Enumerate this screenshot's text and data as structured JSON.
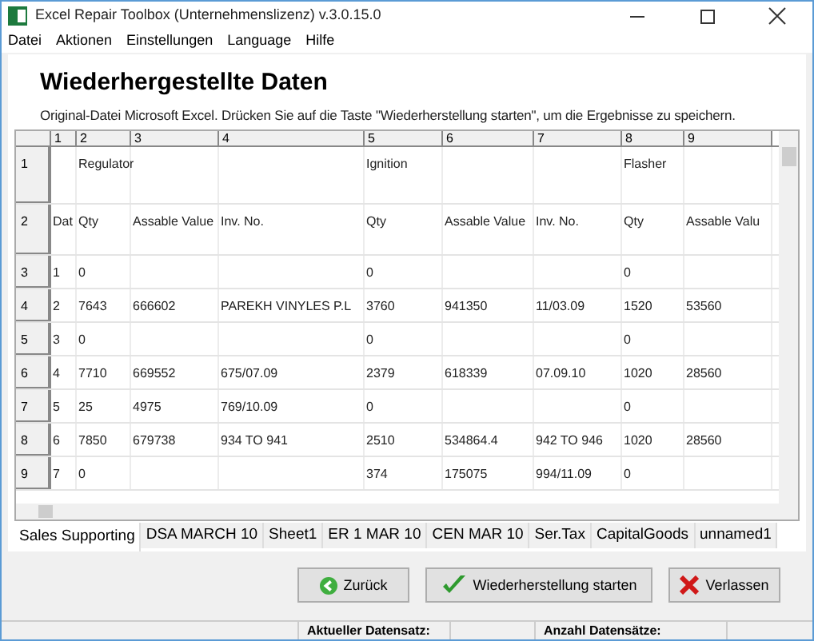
{
  "window": {
    "title": "Excel Repair Toolbox (Unternehmenslizenz) v.3.0.15.0"
  },
  "menu": [
    "Datei",
    "Aktionen",
    "Einstellungen",
    "Language",
    "Hilfe"
  ],
  "heading": "Wiederhergestellte Daten",
  "description": "Original-Datei Microsoft Excel. Drücken Sie auf die Taste \"Wiederherstellung starten\", um die Ergebnisse zu speichern.",
  "grid": {
    "columns": [
      "1",
      "2",
      "3",
      "4",
      "5",
      "6",
      "7",
      "8",
      "9"
    ],
    "rows": [
      {
        "header": "1",
        "cells": [
          null,
          "Regulator",
          null,
          null,
          "Ignition",
          null,
          null,
          "Flasher",
          null
        ]
      },
      {
        "header": "2",
        "cells": [
          "Dat",
          "Qty",
          "Assable Value",
          "Inv. No.",
          "Qty",
          "Assable Value",
          "Inv. No.",
          "Qty",
          "Assable Valu"
        ]
      },
      {
        "header": "3",
        "cells": [
          "1",
          "0",
          null,
          null,
          "0",
          null,
          null,
          "0",
          null
        ]
      },
      {
        "header": "4",
        "cells": [
          "2",
          "7643",
          "666602",
          "PAREKH VINYLES P.L",
          "3760",
          "941350",
          "11/03.09",
          "1520",
          "53560"
        ]
      },
      {
        "header": "5",
        "cells": [
          "3",
          "0",
          null,
          null,
          "0",
          null,
          null,
          "0",
          null
        ]
      },
      {
        "header": "6",
        "cells": [
          "4",
          "7710",
          "669552",
          "675/07.09",
          "2379",
          "618339",
          "07.09.10",
          "1020",
          "28560"
        ]
      },
      {
        "header": "7",
        "cells": [
          "5",
          "25",
          "4975",
          "769/10.09",
          "0",
          null,
          null,
          "0",
          null
        ]
      },
      {
        "header": "8",
        "cells": [
          "6",
          "7850",
          "679738",
          "934 TO 941",
          "2510",
          "534864.4",
          "942 TO 946",
          "1020",
          "28560"
        ]
      },
      {
        "header": "9",
        "cells": [
          "7",
          "0",
          null,
          null,
          "374",
          "175075",
          "994/11.09",
          "0",
          null
        ]
      }
    ]
  },
  "sheets": [
    {
      "label": "Sales Supporting",
      "selected": true
    },
    {
      "label": "DSA MARCH 10",
      "selected": false
    },
    {
      "label": "Sheet1",
      "selected": false
    },
    {
      "label": "ER 1 MAR 10",
      "selected": false
    },
    {
      "label": "CEN MAR 10",
      "selected": false
    },
    {
      "label": "Ser.Tax",
      "selected": false
    },
    {
      "label": "CapitalGoods",
      "selected": false
    },
    {
      "label": "unnamed1",
      "selected": false
    }
  ],
  "buttons": [
    {
      "kind": "back",
      "label": "Zurück"
    },
    {
      "kind": "start",
      "label": "Wiederherstellung starten"
    },
    {
      "kind": "exit",
      "label": "Verlassen"
    }
  ],
  "status_bar": [
    "Aktueller Datensatz:",
    "Anzahl Datensätze:"
  ]
}
